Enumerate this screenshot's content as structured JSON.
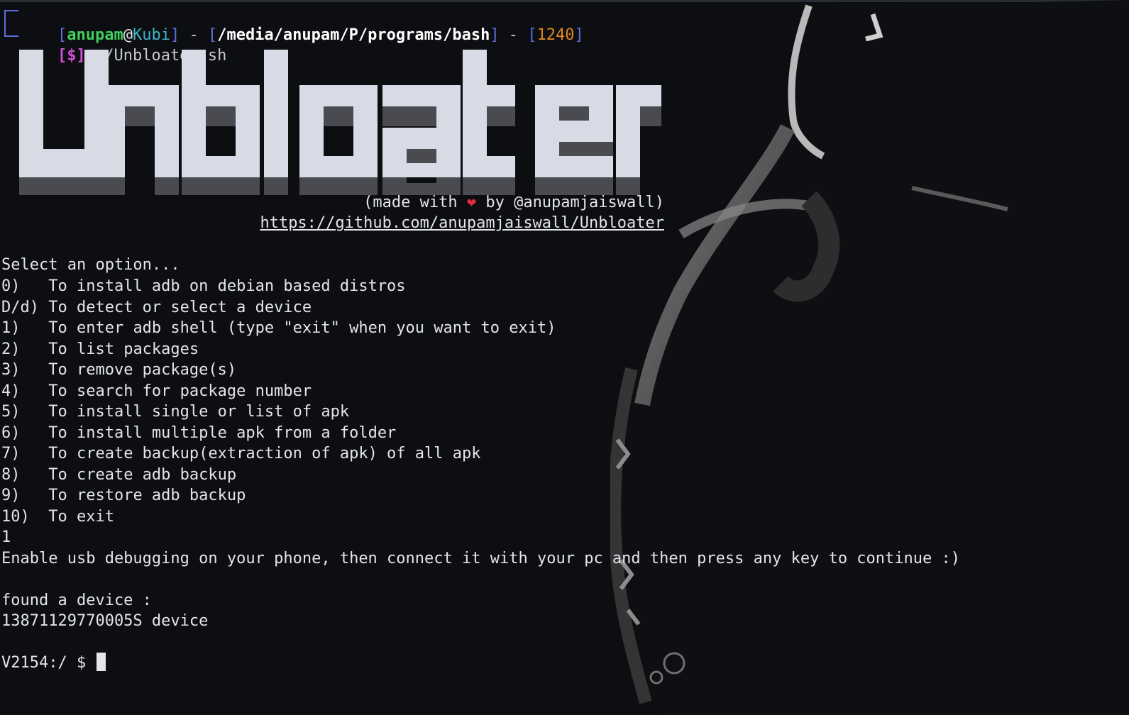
{
  "prompt": {
    "user": "anupam",
    "at": "@",
    "host": "Kubi",
    "separator": " - ",
    "path": "/media/anupam/P/programs/bash",
    "code": "1240",
    "dollar": "[$]",
    "command": " ./Unbloater.sh"
  },
  "banner": {
    "title": "Unbloater",
    "credit_pre": "(made with ",
    "heart": "❤",
    "credit_post": " by @anupamjaiswall)",
    "url": "https://github.com/anupamjaiswall/Unbloater"
  },
  "menu": {
    "header": "Select an option...",
    "options": [
      {
        "key": "0)   ",
        "text": "To install adb on debian based distros"
      },
      {
        "key": "D/d) ",
        "text": "To detect or select a device"
      },
      {
        "key": "1)   ",
        "text": "To enter adb shell (type \"exit\" when you want to exit)"
      },
      {
        "key": "2)   ",
        "text": "To list packages"
      },
      {
        "key": "3)   ",
        "text": "To remove package(s)"
      },
      {
        "key": "4)   ",
        "text": "To search for package number"
      },
      {
        "key": "5)   ",
        "text": "To install single or list of apk"
      },
      {
        "key": "6)   ",
        "text": "To install multiple apk from a folder"
      },
      {
        "key": "7)   ",
        "text": "To create backup(extraction of apk) of all apk"
      },
      {
        "key": "8)   ",
        "text": "To create adb backup"
      },
      {
        "key": "9)   ",
        "text": "To restore adb backup"
      },
      {
        "key": "10)  ",
        "text": "To exit"
      }
    ]
  },
  "session": {
    "input": "1",
    "instruction": "Enable usb debugging on your phone, then connect it with your pc and then press any key to continue :)",
    "found_label": "found a device :",
    "device_line": "13871129770005S device",
    "shell_prompt": "V2154:/ $ "
  },
  "colors": {
    "background": "#0c0e12",
    "bracket": "#5b6ee1",
    "user": "#3ecf5c",
    "host": "#3fb4c8",
    "code": "#e0861f",
    "dollar": "#d14fd6",
    "heart": "#e0303a"
  }
}
